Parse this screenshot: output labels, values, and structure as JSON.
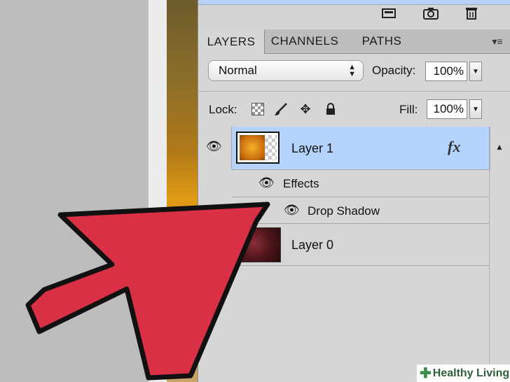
{
  "tabs": [
    {
      "label": "LAYERS",
      "active": true
    },
    {
      "label": "CHANNELS",
      "active": false
    },
    {
      "label": "PATHS",
      "active": false
    }
  ],
  "blend_mode": {
    "value": "Normal"
  },
  "opacity": {
    "label": "Opacity:",
    "value": "100%"
  },
  "lock": {
    "label": "Lock:"
  },
  "fill": {
    "label": "Fill:",
    "value": "100%"
  },
  "layers": {
    "layer1": {
      "name": "Layer 1",
      "fx": "fx"
    },
    "effects": {
      "label": "Effects"
    },
    "drop_shadow": {
      "label": "Drop Shadow"
    },
    "layer0": {
      "name": "Layer 0"
    }
  },
  "watermark": {
    "brand": "Healthy Living"
  },
  "colors": {
    "selected_row": "#b3d3fb",
    "arrow": "#d93045",
    "panel": "#d6d6d6"
  }
}
